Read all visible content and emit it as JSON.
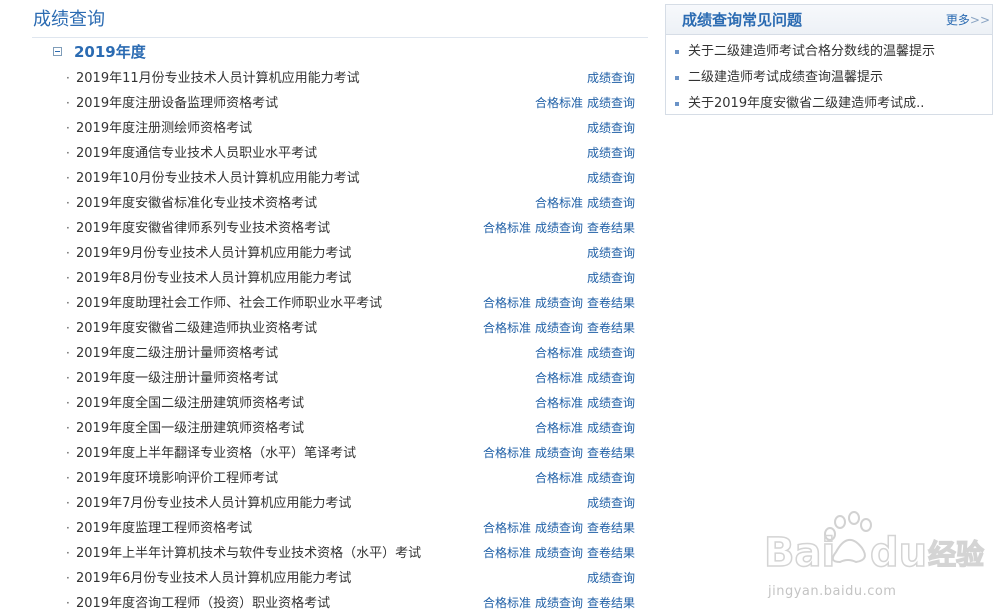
{
  "main": {
    "title": "成绩查询",
    "year": "2019年度",
    "bullet": "·",
    "exams": [
      {
        "name": "2019年11月份专业技术人员计算机应用能力考试",
        "links": [
          "成绩查询"
        ]
      },
      {
        "name": "2019年度注册设备监理师资格考试",
        "links": [
          "合格标准",
          "成绩查询"
        ]
      },
      {
        "name": "2019年度注册测绘师资格考试",
        "links": [
          "成绩查询"
        ]
      },
      {
        "name": "2019年度通信专业技术人员职业水平考试",
        "links": [
          "成绩查询"
        ]
      },
      {
        "name": "2019年10月份专业技术人员计算机应用能力考试",
        "links": [
          "成绩查询"
        ]
      },
      {
        "name": "2019年度安徽省标准化专业技术资格考试",
        "links": [
          "合格标准",
          "成绩查询"
        ]
      },
      {
        "name": "2019年度安徽省律师系列专业技术资格考试",
        "links": [
          "合格标准",
          "成绩查询",
          "查卷结果"
        ]
      },
      {
        "name": "2019年9月份专业技术人员计算机应用能力考试",
        "links": [
          "成绩查询"
        ]
      },
      {
        "name": "2019年8月份专业技术人员计算机应用能力考试",
        "links": [
          "成绩查询"
        ]
      },
      {
        "name": "2019年度助理社会工作师、社会工作师职业水平考试",
        "links": [
          "合格标准",
          "成绩查询",
          "查卷结果"
        ]
      },
      {
        "name": "2019年度安徽省二级建造师执业资格考试",
        "links": [
          "合格标准",
          "成绩查询",
          "查卷结果"
        ]
      },
      {
        "name": "2019年度二级注册计量师资格考试",
        "links": [
          "合格标准",
          "成绩查询"
        ]
      },
      {
        "name": "2019年度一级注册计量师资格考试",
        "links": [
          "合格标准",
          "成绩查询"
        ]
      },
      {
        "name": "2019年度全国二级注册建筑师资格考试",
        "links": [
          "合格标准",
          "成绩查询"
        ]
      },
      {
        "name": "2019年度全国一级注册建筑师资格考试",
        "links": [
          "合格标准",
          "成绩查询"
        ]
      },
      {
        "name": "2019年度上半年翻译专业资格（水平）笔译考试",
        "links": [
          "合格标准",
          "成绩查询",
          "查卷结果"
        ]
      },
      {
        "name": "2019年度环境影响评价工程师考试",
        "links": [
          "合格标准",
          "成绩查询"
        ]
      },
      {
        "name": "2019年7月份专业技术人员计算机应用能力考试",
        "links": [
          "成绩查询"
        ]
      },
      {
        "name": "2019年度监理工程师资格考试",
        "links": [
          "合格标准",
          "成绩查询",
          "查卷结果"
        ]
      },
      {
        "name": "2019年上半年计算机技术与软件专业技术资格（水平）考试",
        "links": [
          "合格标准",
          "成绩查询",
          "查卷结果"
        ]
      },
      {
        "name": "2019年6月份专业技术人员计算机应用能力考试",
        "links": [
          "成绩查询"
        ]
      },
      {
        "name": "2019年度咨询工程师（投资）职业资格考试",
        "links": [
          "合格标准",
          "成绩查询",
          "查卷结果"
        ]
      }
    ]
  },
  "faq": {
    "title": "成绩查询常见问题",
    "more_label": "更多",
    "more_arrow": ">>",
    "items": [
      "关于二级建造师考试合格分数线的温馨提示",
      "二级建造师考试成绩查询温馨提示",
      "关于2019年度安徽省二级建造师考试成.."
    ]
  },
  "watermark": {
    "url": "jingyan.baidu.com"
  },
  "colors": {
    "accent": "#2b6bb2",
    "link": "#1f5fa6",
    "text": "#333333",
    "border": "#d6dde6"
  }
}
